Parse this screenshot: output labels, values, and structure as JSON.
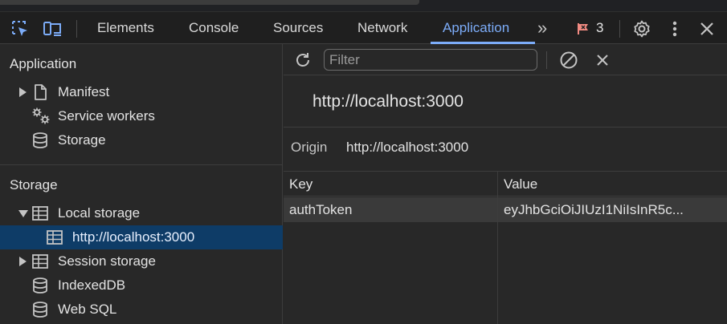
{
  "toolbar": {
    "tabs": [
      {
        "label": "Elements"
      },
      {
        "label": "Console"
      },
      {
        "label": "Sources"
      },
      {
        "label": "Network"
      },
      {
        "label": "Application"
      }
    ],
    "more_tabs_glyph": "»",
    "issues_count": "3",
    "icons": [
      "inspect-element-icon",
      "device-toolbar-icon",
      "more-tabs-icon",
      "issues-flag-icon",
      "settings-gear-icon",
      "kebab-menu-icon",
      "close-icon"
    ],
    "accent_color": "#7cacf8",
    "issues_color": "#f28b82"
  },
  "sidebar": {
    "application_section": {
      "title": "Application",
      "items": [
        {
          "label": "Manifest",
          "icon": "file-icon"
        },
        {
          "label": "Service workers",
          "icon": "gears-icon"
        },
        {
          "label": "Storage",
          "icon": "database-icon"
        }
      ]
    },
    "storage_section": {
      "title": "Storage",
      "items": [
        {
          "label": "Local storage",
          "icon": "table-icon",
          "expanded": true
        },
        {
          "label": "http://localhost:3000",
          "icon": "table-icon",
          "selected": true
        },
        {
          "label": "Session storage",
          "icon": "table-icon",
          "expanded": false
        },
        {
          "label": "IndexedDB",
          "icon": "database-icon"
        },
        {
          "label": "Web SQL",
          "icon": "database-icon"
        }
      ]
    },
    "selected_color": "#0e3c67"
  },
  "main": {
    "filter_placeholder": "Filter",
    "filter_value": "",
    "origin_heading": "http://localhost:3000",
    "origin_label": "Origin",
    "origin_value": "http://localhost:3000",
    "table": {
      "columns": [
        "Key",
        "Value"
      ],
      "rows": [
        {
          "key": "authToken",
          "value": "eyJhbGciOiJIUzI1NiIsInR5c..."
        }
      ]
    }
  }
}
